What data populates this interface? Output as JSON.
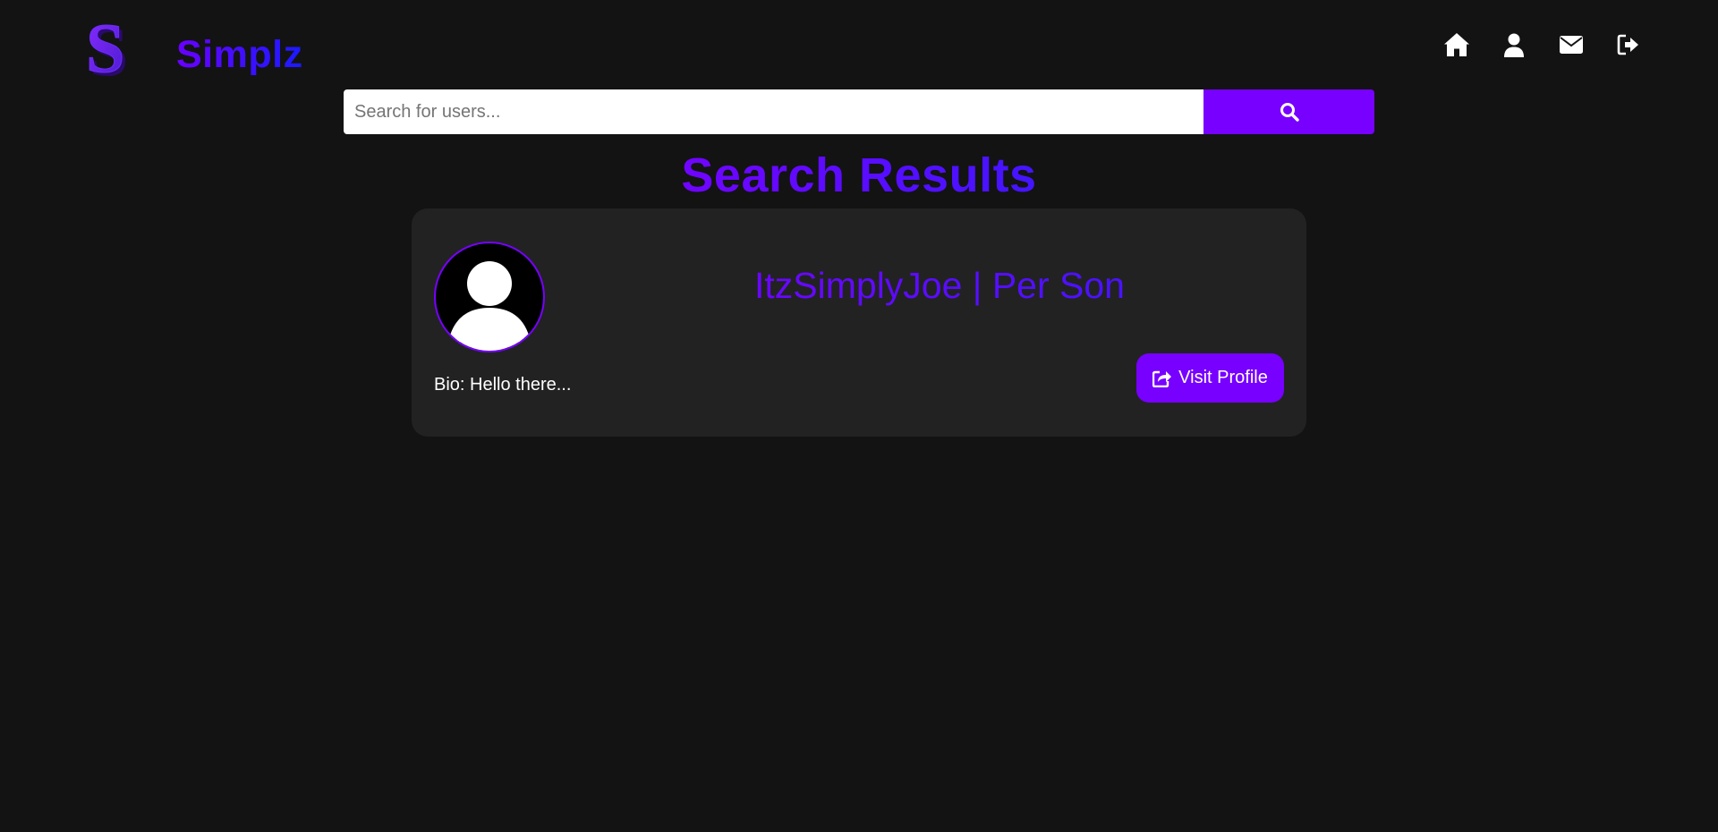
{
  "brand": {
    "logo_letter": "S",
    "name": "Simplz"
  },
  "nav": {
    "items": [
      {
        "icon": "home-icon"
      },
      {
        "icon": "user-icon"
      },
      {
        "icon": "envelope-icon"
      },
      {
        "icon": "sign-out-icon"
      }
    ]
  },
  "search": {
    "value": "",
    "placeholder": "Search for users...",
    "button_icon": "search-icon"
  },
  "results": {
    "title": "Search Results",
    "items": [
      {
        "username": "ItzSimplyJoe | Per Son",
        "bio": "Bio: Hello there...",
        "action_label": "Visit Profile",
        "action_icon": "external-share-icon"
      }
    ]
  },
  "colors": {
    "background": "#131313",
    "card": "#222222",
    "accent": "#7700ff",
    "accent_blue": "#1b1bff"
  }
}
